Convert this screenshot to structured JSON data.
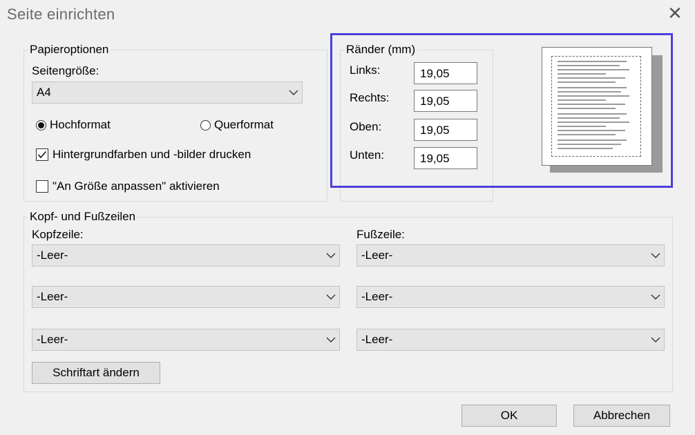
{
  "window": {
    "title": "Seite einrichten",
    "close_icon": "close-icon"
  },
  "paper": {
    "legend": "Papieroptionen",
    "size_label": "Seitengröße:",
    "size_value": "A4",
    "portrait_label": "Hochformat",
    "landscape_label": "Querformat",
    "orientation_selected": "Hochformat",
    "print_backgrounds_label": "Hintergrundfarben und -bilder drucken",
    "print_backgrounds_checked": true,
    "shrink_to_fit_label": "\"An Größe anpassen\" aktivieren",
    "shrink_to_fit_checked": false
  },
  "margins": {
    "legend": "Ränder (mm)",
    "left_label": "Links:",
    "left_value": "19,05",
    "right_label": "Rechts:",
    "right_value": "19,05",
    "top_label": "Oben:",
    "top_value": "19,05",
    "bottom_label": "Unten:",
    "bottom_value": "19,05"
  },
  "headers_footers": {
    "legend": "Kopf- und Fußzeilen",
    "header_label": "Kopfzeile:",
    "footer_label": "Fußzeile:",
    "header_values": [
      "-Leer-",
      "-Leer-",
      "-Leer-"
    ],
    "footer_values": [
      "-Leer-",
      "-Leer-",
      "-Leer-"
    ],
    "change_font_label": "Schriftart ändern"
  },
  "buttons": {
    "ok": "OK",
    "cancel": "Abbrechen"
  },
  "colors": {
    "highlight": "#4b3fdb",
    "background": "#f0f0f0"
  }
}
